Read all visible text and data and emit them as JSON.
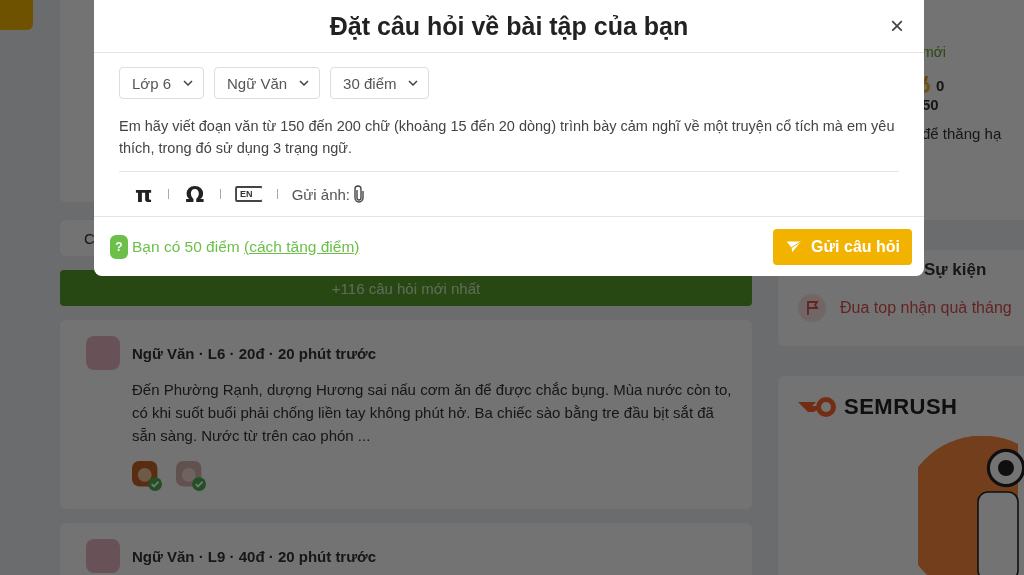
{
  "background": {
    "feed": {
      "tab_fragment": "C",
      "new_questions": "+116 câu hỏi mới nhất",
      "posts": [
        {
          "header": "Ngữ Văn · L6 · 20đ · 20 phút trước",
          "excerpt": "Đến Phường Rạnh, dượng Hương sai nấu cơm ăn để được chắc bụng. Mùa nước còn to, có khi suốt buổi phải chống liền tay không phút hở. Ba chiếc sào bằng tre đầu bịt sắt đã sẵn sàng. Nước từ trên cao phón ..."
        },
        {
          "header": "Ngữ Văn · L9 · 40đ · 20 phút trước"
        }
      ]
    },
    "sidebar": {
      "profile": {
        "fragment": "mới",
        "medal_count": "0",
        "points": "50",
        "hint": "để thăng hạ"
      },
      "events": {
        "title": "Sự kiện",
        "items": [
          {
            "label": "Đua top nhận quà tháng"
          }
        ]
      },
      "ad": {
        "brand": "SEMRUSH"
      }
    }
  },
  "modal": {
    "title": "Đặt câu hỏi về bài tập của bạn",
    "close": "×",
    "selects": [
      {
        "value": "Lớp 6"
      },
      {
        "value": "Ngữ Văn"
      },
      {
        "value": "30 điểm"
      }
    ],
    "question": "Em hãy viết đoạn văn từ 150 đến 200 chữ (khoảng 15 đến 20 dòng) trình bày cảm nghĩ về một truyện cổ tích mà em yêu thích, trong đó sử dụng 3 trạng ngữ.",
    "toolbar": [
      {
        "kind": "glyph",
        "label": "π"
      },
      {
        "kind": "glyph",
        "label": "Ω"
      },
      {
        "kind": "tag",
        "label": "EN"
      },
      {
        "kind": "attach",
        "label": "Gửi ảnh:"
      }
    ],
    "help_icon": "?",
    "points_text": "Bạn có 50 điểm",
    "points_link": "(cách tăng điểm)",
    "submit": "Gửi câu hỏi"
  }
}
